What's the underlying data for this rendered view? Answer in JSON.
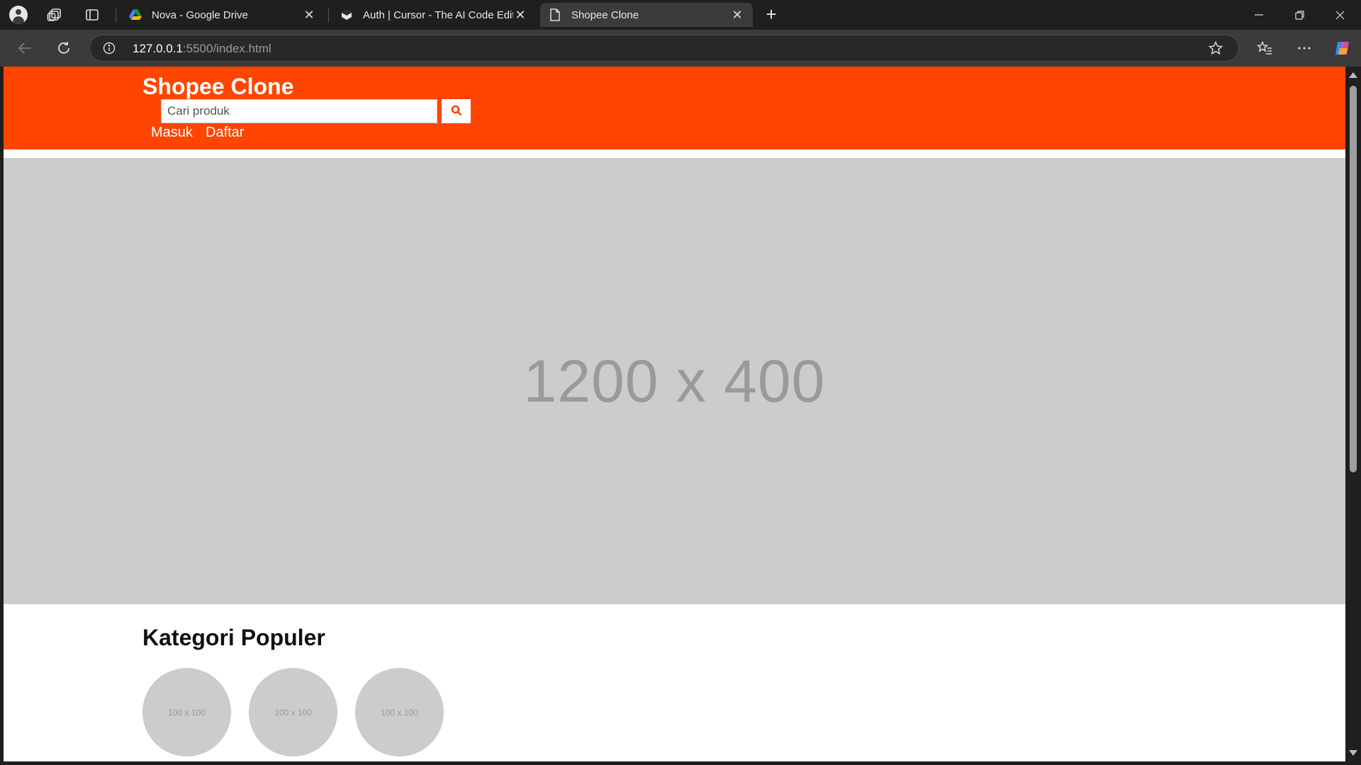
{
  "browser": {
    "tabs": [
      {
        "title": "Nova - Google Drive",
        "icon": "google-drive-icon",
        "active": false
      },
      {
        "title": "Auth | Cursor - The AI Code Editor",
        "icon": "cursor-icon",
        "active": false
      },
      {
        "title": "Shopee Clone",
        "icon": "page-icon",
        "active": true
      }
    ],
    "url_host": "127.0.0.1",
    "url_rest": ":5500/index.html",
    "colors": {
      "chrome_dark": "#1f1f1f",
      "toolbar": "#3b3b3b"
    }
  },
  "site": {
    "logo": "Shopee Clone",
    "search_placeholder": "Cari produk",
    "nav": {
      "login": "Masuk",
      "register": "Daftar"
    },
    "banner_text": "1200 x 400",
    "section_title": "Kategori Populer",
    "categories": [
      {
        "label": "100 x 100"
      },
      {
        "label": "100 x 100"
      },
      {
        "label": "100 x 100"
      }
    ],
    "colors": {
      "brand": "#ff4500",
      "placeholder_bg": "#cccccc",
      "placeholder_text": "#9a9a9a"
    }
  }
}
